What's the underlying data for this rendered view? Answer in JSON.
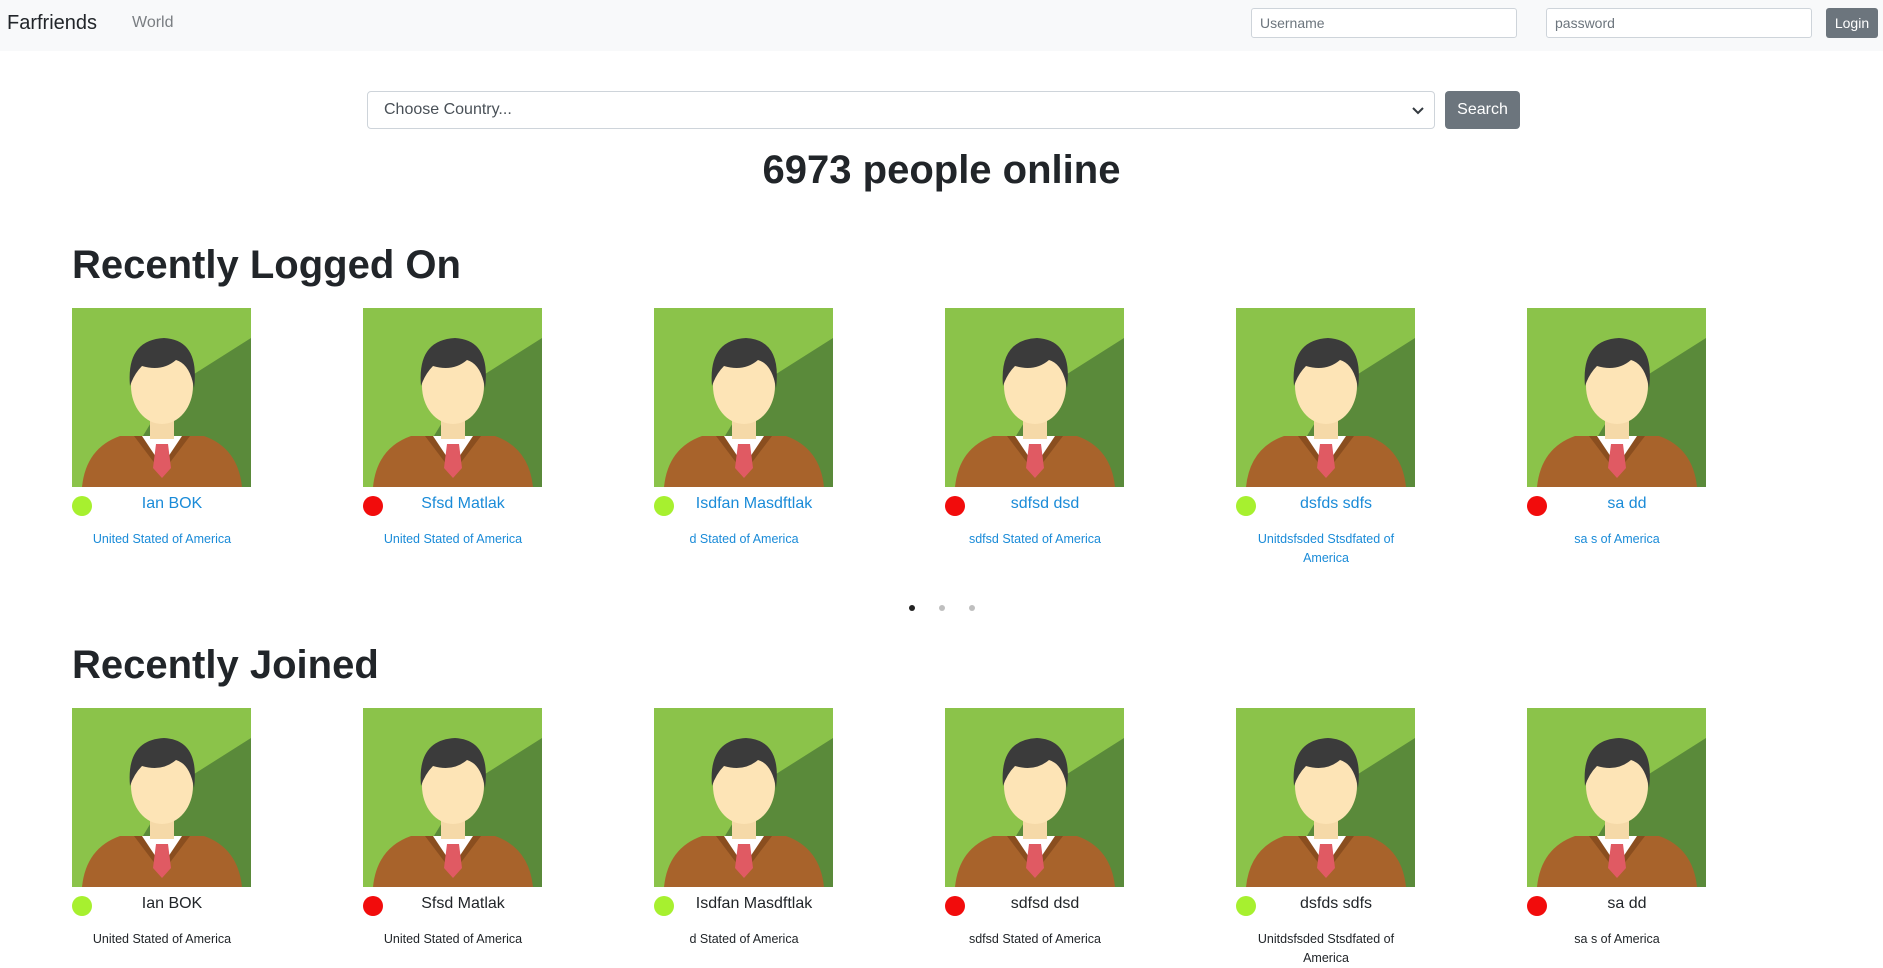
{
  "nav": {
    "brand": "Farfriends",
    "world_link": "World",
    "username_placeholder": "Username",
    "password_placeholder": "password",
    "login_label": "Login"
  },
  "search": {
    "country_placeholder": "Choose Country...",
    "search_label": "Search"
  },
  "online_count": "6973 people online",
  "sections": {
    "recent_logged": {
      "title": "Recently Logged On",
      "users": [
        {
          "name": "Ian BOK",
          "country": "United Stated of America",
          "status": "online"
        },
        {
          "name": "Sfsd Matlak",
          "country": "United Stated of America",
          "status": "offline"
        },
        {
          "name": "Isdfan Masdftlak",
          "country": "d Stated of America",
          "status": "online"
        },
        {
          "name": "sdfsd dsd",
          "country": "sdfsd Stated of America",
          "status": "offline"
        },
        {
          "name": "dsfds sdfs",
          "country": "Unitdsfsded Stsdfated of America",
          "status": "online"
        },
        {
          "name": "sa dd",
          "country": "sa s of America",
          "status": "offline"
        }
      ]
    },
    "recent_joined": {
      "title": "Recently Joined",
      "users": [
        {
          "name": "Ian BOK",
          "country": "United Stated of America",
          "status": "online"
        },
        {
          "name": "Sfsd Matlak",
          "country": "United Stated of America",
          "status": "offline"
        },
        {
          "name": "Isdfan Masdftlak",
          "country": "d Stated of America",
          "status": "online"
        },
        {
          "name": "sdfsd dsd",
          "country": "sdfsd Stated of America",
          "status": "offline"
        },
        {
          "name": "dsfds sdfs",
          "country": "Unitdsfsded Stsdfated of America",
          "status": "online"
        },
        {
          "name": "sa dd",
          "country": "sa s of America",
          "status": "offline"
        }
      ]
    }
  },
  "colors": {
    "online": "#a7f02f",
    "offline": "#f20c0c",
    "link": "#1a8bd8",
    "button": "#6c757d",
    "navbar": "#f8f9fa"
  },
  "carousel": {
    "pages": 3,
    "active": 0
  }
}
